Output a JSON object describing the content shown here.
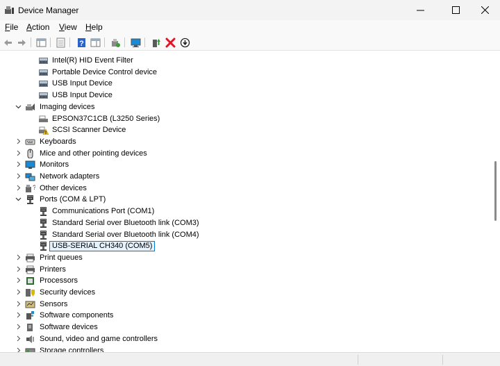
{
  "window": {
    "title": "Device Manager",
    "icon": "device-manager-icon"
  },
  "menu": [
    {
      "label": "File",
      "accel": "F",
      "rest": "ile"
    },
    {
      "label": "Action",
      "accel": "A",
      "rest": "ction"
    },
    {
      "label": "View",
      "accel": "V",
      "rest": "iew"
    },
    {
      "label": "Help",
      "accel": "H",
      "rest": "elp"
    }
  ],
  "toolbar": [
    "back-icon",
    "forward-icon",
    "show-hide-tree-icon",
    "properties-icon",
    "help-icon",
    "action-pane-icon",
    "update-driver-icon",
    "scan-hardware-icon",
    "enable-device-icon",
    "uninstall-device-icon",
    "download-icon"
  ],
  "colors": {
    "selection_border": "#0078d4",
    "selection_fill": "#e5f1fb",
    "uninstall_red": "#e81123",
    "help_blue": "#2a62c9",
    "monitor_blue": "#1a8ad4"
  },
  "tree": {
    "rows": [
      {
        "label": "Intel(R) HID Event Filter",
        "level": 1,
        "icon": "hid-icon"
      },
      {
        "label": "Portable Device Control device",
        "level": 1,
        "icon": "hid-icon"
      },
      {
        "label": "USB Input Device",
        "level": 1,
        "icon": "hid-icon"
      },
      {
        "label": "USB Input Device",
        "level": 1,
        "icon": "hid-icon"
      },
      {
        "label": "Imaging devices",
        "level": 0,
        "icon": "camera-icon",
        "expanded": true
      },
      {
        "label": "EPSON37C1CB (L3250 Series)",
        "level": 1,
        "icon": "scanner-icon"
      },
      {
        "label": "SCSI Scanner Device",
        "level": 1,
        "icon": "scanner-warning-icon"
      },
      {
        "label": "Keyboards",
        "level": 0,
        "icon": "keyboard-icon",
        "expanded": false
      },
      {
        "label": "Mice and other pointing devices",
        "level": 0,
        "icon": "mouse-icon",
        "expanded": false
      },
      {
        "label": "Monitors",
        "level": 0,
        "icon": "monitor-icon",
        "expanded": false
      },
      {
        "label": "Network adapters",
        "level": 0,
        "icon": "network-icon",
        "expanded": false
      },
      {
        "label": "Other devices",
        "level": 0,
        "icon": "unknown-device-icon",
        "expanded": false
      },
      {
        "label": "Ports (COM & LPT)",
        "level": 0,
        "icon": "port-icon",
        "expanded": true
      },
      {
        "label": "Communications Port (COM1)",
        "level": 1,
        "icon": "port-icon"
      },
      {
        "label": "Standard Serial over Bluetooth link (COM3)",
        "level": 1,
        "icon": "port-icon"
      },
      {
        "label": "Standard Serial over Bluetooth link (COM4)",
        "level": 1,
        "icon": "port-icon"
      },
      {
        "label": "USB-SERIAL CH340 (COM5)",
        "level": 1,
        "icon": "port-icon",
        "selected": true
      },
      {
        "label": "Print queues",
        "level": 0,
        "icon": "printer-icon",
        "expanded": false
      },
      {
        "label": "Printers",
        "level": 0,
        "icon": "printer-icon",
        "expanded": false
      },
      {
        "label": "Processors",
        "level": 0,
        "icon": "processor-icon",
        "expanded": false
      },
      {
        "label": "Security devices",
        "level": 0,
        "icon": "security-icon",
        "expanded": false
      },
      {
        "label": "Sensors",
        "level": 0,
        "icon": "sensor-icon",
        "expanded": false
      },
      {
        "label": "Software components",
        "level": 0,
        "icon": "software-component-icon",
        "expanded": false
      },
      {
        "label": "Software devices",
        "level": 0,
        "icon": "software-device-icon",
        "expanded": false
      },
      {
        "label": "Sound, video and game controllers",
        "level": 0,
        "icon": "speaker-icon",
        "expanded": false
      },
      {
        "label": "Storage controllers",
        "level": 0,
        "icon": "storage-icon",
        "expanded": false
      }
    ]
  }
}
